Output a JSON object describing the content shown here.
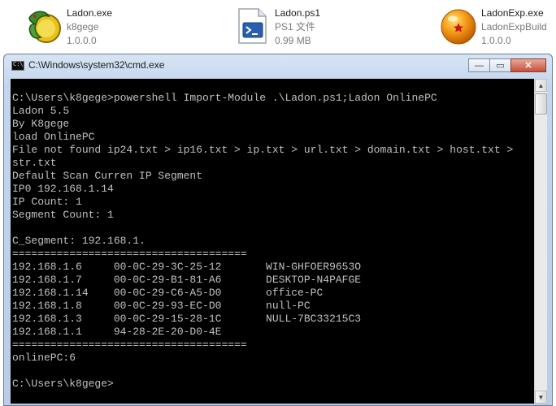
{
  "files": [
    {
      "name": "Ladon.exe",
      "type": "k8gege",
      "size": "1.0.0.0",
      "icon": "dragon-app-icon"
    },
    {
      "name": "Ladon.ps1",
      "type": "PS1 文件",
      "size": "0.99 MB",
      "icon": "powershell-script-icon"
    },
    {
      "name": "LadonExp.exe",
      "type": "LadonExpBuild",
      "size": "1.0.0.0",
      "icon": "dragon-ball-icon"
    }
  ],
  "window": {
    "title": "C:\\Windows\\system32\\cmd.exe",
    "minimize": "—",
    "maximize": "▭",
    "close": "✕"
  },
  "console": {
    "lines": [
      "C:\\Users\\k8gege>powershell Import-Module .\\Ladon.ps1;Ladon OnlinePC",
      "Ladon 5.5",
      "By K8gege",
      "load OnlinePC",
      "File not found ip24.txt > ip16.txt > ip.txt > url.txt > domain.txt > host.txt >",
      "str.txt",
      "Default Scan Curren IP Segment",
      "IP0 192.168.1.14",
      "IP Count: 1",
      "Segment Count: 1",
      "",
      "C_Segment: 192.168.1.",
      "=====================================",
      "192.168.1.6     00-0C-29-3C-25-12       WIN-GHFOER9653O",
      "192.168.1.7     00-0C-29-B1-81-A6       DESKTOP-N4PAFGE",
      "192.168.1.14    00-0C-29-C6-A5-D0       office-PC",
      "192.168.1.8     00-0C-29-93-EC-D0       null-PC",
      "192.168.1.3     00-0C-29-15-28-1C       NULL-7BC33215C3",
      "192.168.1.1     94-28-2E-20-D0-4E",
      "=====================================",
      "onlinePC:6",
      "",
      "C:\\Users\\k8gege>"
    ]
  },
  "colors": {
    "console_bg": "#000000",
    "console_fg": "#c0c0c0",
    "title_bar": "#c3d6ee",
    "close_button": "#c7503a"
  }
}
